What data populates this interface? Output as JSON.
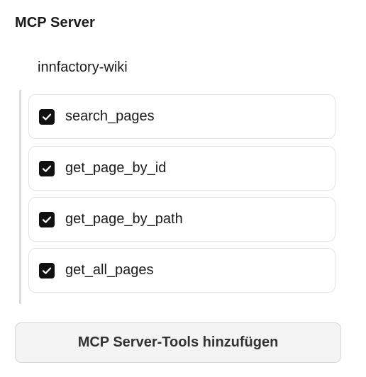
{
  "section": {
    "title": "MCP Server"
  },
  "server": {
    "name": "innfactory-wiki",
    "tools": [
      {
        "label": "search_pages",
        "checked": true
      },
      {
        "label": "get_page_by_id",
        "checked": true
      },
      {
        "label": "get_page_by_path",
        "checked": true
      },
      {
        "label": "get_all_pages",
        "checked": true
      }
    ]
  },
  "actions": {
    "add_tools_label": "MCP Server-Tools hinzufügen"
  },
  "icons": {
    "checkbox": "checkbox-checked-icon"
  },
  "colors": {
    "checkbox_fill": "#111111",
    "button_bg": "#f4f4f4"
  }
}
